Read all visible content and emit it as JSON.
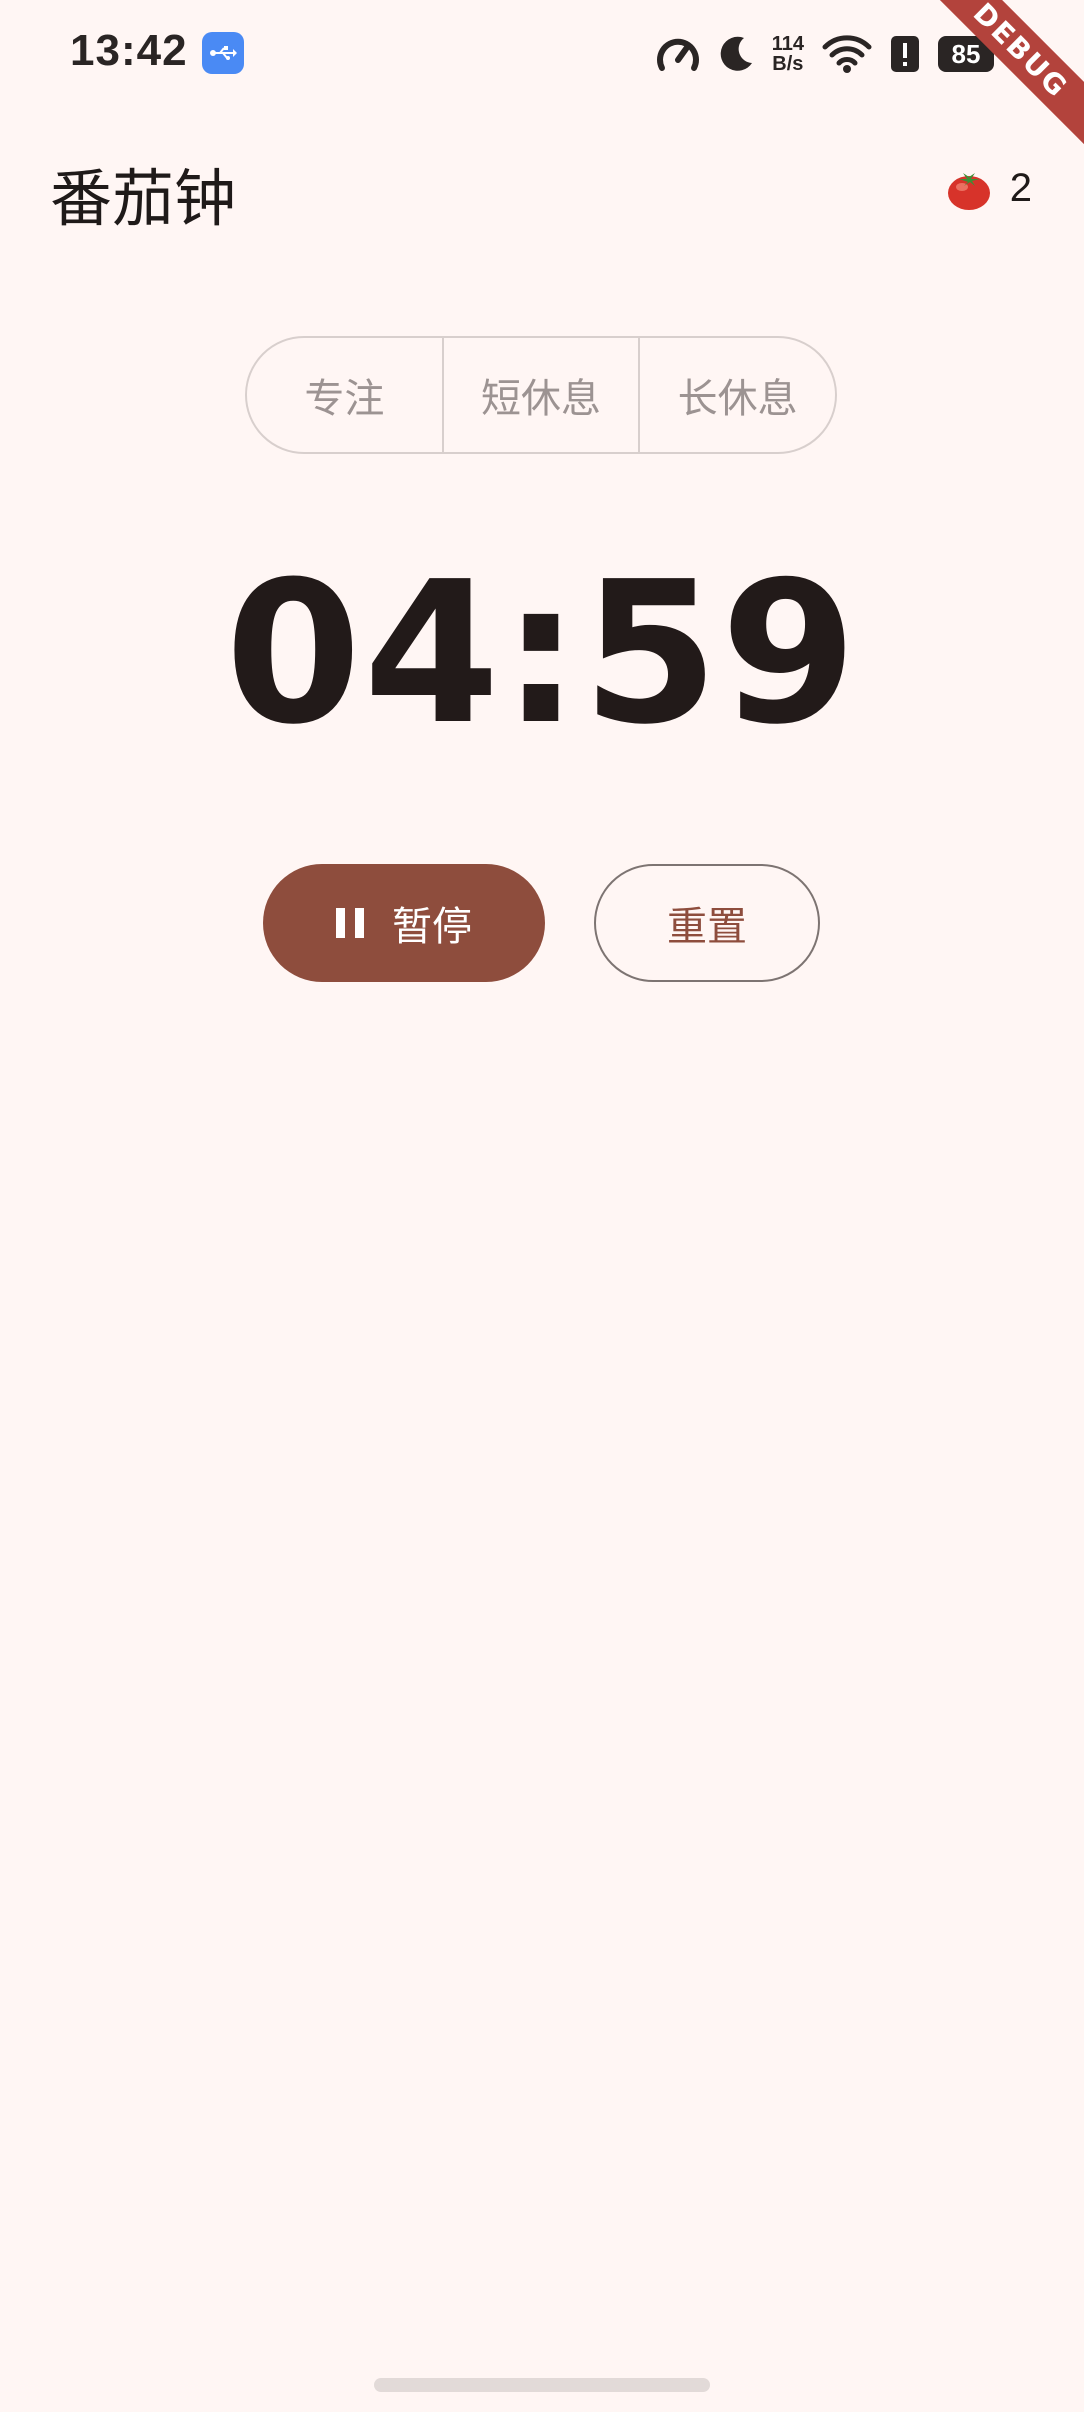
{
  "status_bar": {
    "time": "13:42",
    "net_speed_value": "114",
    "net_speed_unit": "B/s",
    "battery": "85",
    "icons": [
      "usb-icon",
      "speed-meter-icon",
      "moon-icon",
      "wifi-icon",
      "alert-icon",
      "battery-icon"
    ]
  },
  "debug_banner": "DEBUG",
  "app_bar": {
    "title": "番茄钟",
    "tomato_count": "2"
  },
  "mode_selector": {
    "segments": [
      "专注",
      "短休息",
      "长休息"
    ]
  },
  "timer": {
    "display": "04:59"
  },
  "controls": {
    "pause_label": "暂停",
    "reset_label": "重置"
  },
  "colors": {
    "background": "#FFF6F4",
    "primary": "#8E4D3D",
    "outline": "#D8CFCD",
    "debug": "#B3433C"
  }
}
